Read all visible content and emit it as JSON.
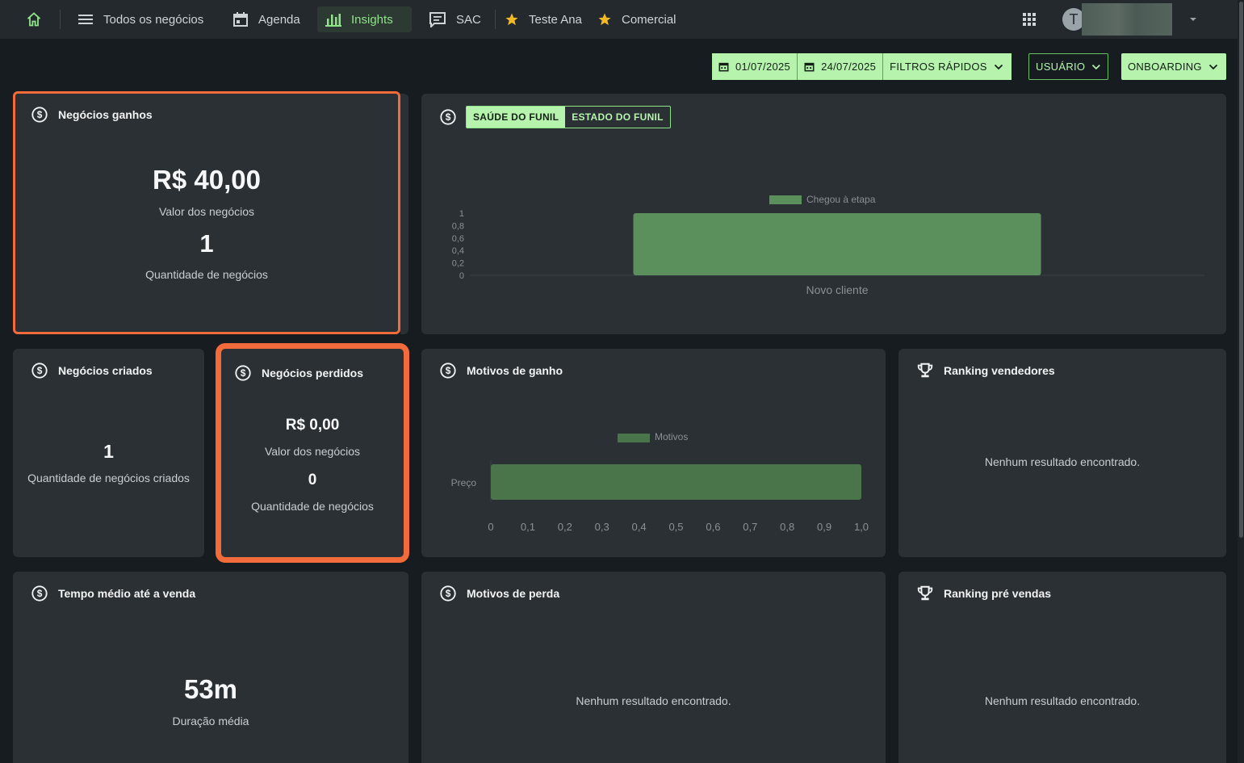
{
  "nav": {
    "items": [
      {
        "label": "Todos os negócios"
      },
      {
        "label": "Agenda"
      },
      {
        "label": "Insights"
      },
      {
        "label": "SAC"
      },
      {
        "label": "Teste Ana"
      },
      {
        "label": "Comercial"
      }
    ],
    "avatar_initial": "T"
  },
  "filters": {
    "date_start": "01/07/2025",
    "date_end": "24/07/2025",
    "quick_filters": "FILTROS RÁPIDOS",
    "user": "USUÁRIO",
    "pipeline": "ONBOARDING"
  },
  "won": {
    "title": "Negócios ganhos",
    "value": "R$ 40,00",
    "value_label": "Valor dos negócios",
    "count": "1",
    "count_label": "Quantidade de negócios"
  },
  "funnel": {
    "tab_health": "SAÚDE DO FUNIL",
    "tab_state": "ESTADO DO FUNIL"
  },
  "created": {
    "title": "Negócios criados",
    "count": "1",
    "count_label": "Quantidade de negócios criados"
  },
  "lost": {
    "title": "Negócios perdidos",
    "value": "R$ 0,00",
    "value_label": "Valor dos negócios",
    "count": "0",
    "count_label": "Quantidade de negócios"
  },
  "win_reasons": {
    "title": "Motivos de ganho"
  },
  "seller_ranking": {
    "title": "Ranking vendedores",
    "empty": "Nenhum resultado encontrado."
  },
  "avg_time": {
    "title": "Tempo médio até a venda",
    "value": "53m",
    "label": "Duração média"
  },
  "loss_reasons": {
    "title": "Motivos de perda",
    "empty": "Nenhum resultado encontrado."
  },
  "presales_ranking": {
    "title": "Ranking pré vendas",
    "empty": "Nenhum resultado encontrado."
  },
  "chart_data": [
    {
      "type": "bar",
      "legend": [
        "Chegou à etapa"
      ],
      "categories": [
        "Novo cliente"
      ],
      "series": [
        {
          "name": "Chegou à etapa",
          "values": [
            1
          ]
        }
      ],
      "yticks": [
        "1",
        "0,8",
        "0,6",
        "0,4",
        "0,2",
        "0"
      ],
      "ylim": [
        0,
        1
      ],
      "color": "#5b8f5b"
    },
    {
      "type": "bar",
      "orientation": "horizontal",
      "legend": [
        "Motivos"
      ],
      "categories": [
        "Preço"
      ],
      "series": [
        {
          "name": "Motivos",
          "values": [
            1
          ]
        }
      ],
      "xticks": [
        "0",
        "0,1",
        "0,2",
        "0,3",
        "0,4",
        "0,5",
        "0,6",
        "0,7",
        "0,8",
        "0,9",
        "1,0"
      ],
      "xlim": [
        0,
        1
      ],
      "color": "#4a744a"
    }
  ],
  "colors": {
    "accent": "#b6f4ae",
    "highlight": "#f26b3a",
    "card": "#2a3034",
    "bg": "#161c20"
  }
}
